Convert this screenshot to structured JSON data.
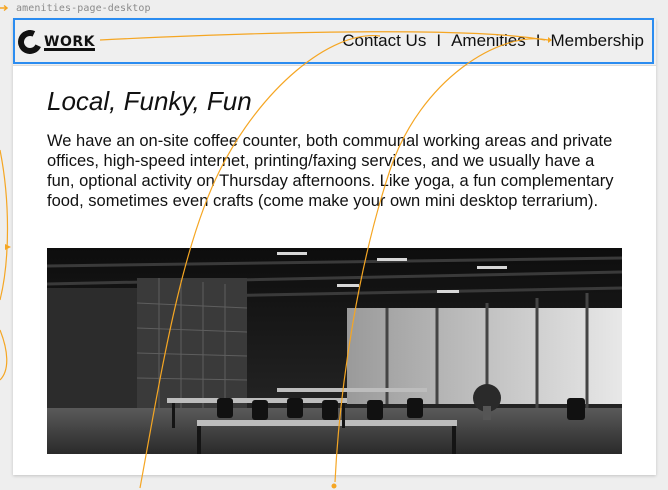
{
  "canvas": {
    "frame_label": "amenities-page-desktop"
  },
  "header": {
    "logo_text": "WORK",
    "nav": [
      {
        "label": "Contact Us"
      },
      {
        "label": "Amenities"
      },
      {
        "label": "Membership"
      }
    ],
    "separator": "I"
  },
  "main": {
    "heading": "Local, Funky, Fun",
    "paragraph": "We have an on-site coffee counter, both communal working areas and private offices, high-speed internet, printing/faxing services, and we usually have a fun, optional activity on Thursday afternoons. Like yoga, a fun complementary food, sometimes even crafts (come make your own mini desktop terrarium).",
    "photo_icon": "coworking-office-photo"
  },
  "colors": {
    "selection": "#2b8cf0",
    "prototype_link": "#f5a623"
  }
}
